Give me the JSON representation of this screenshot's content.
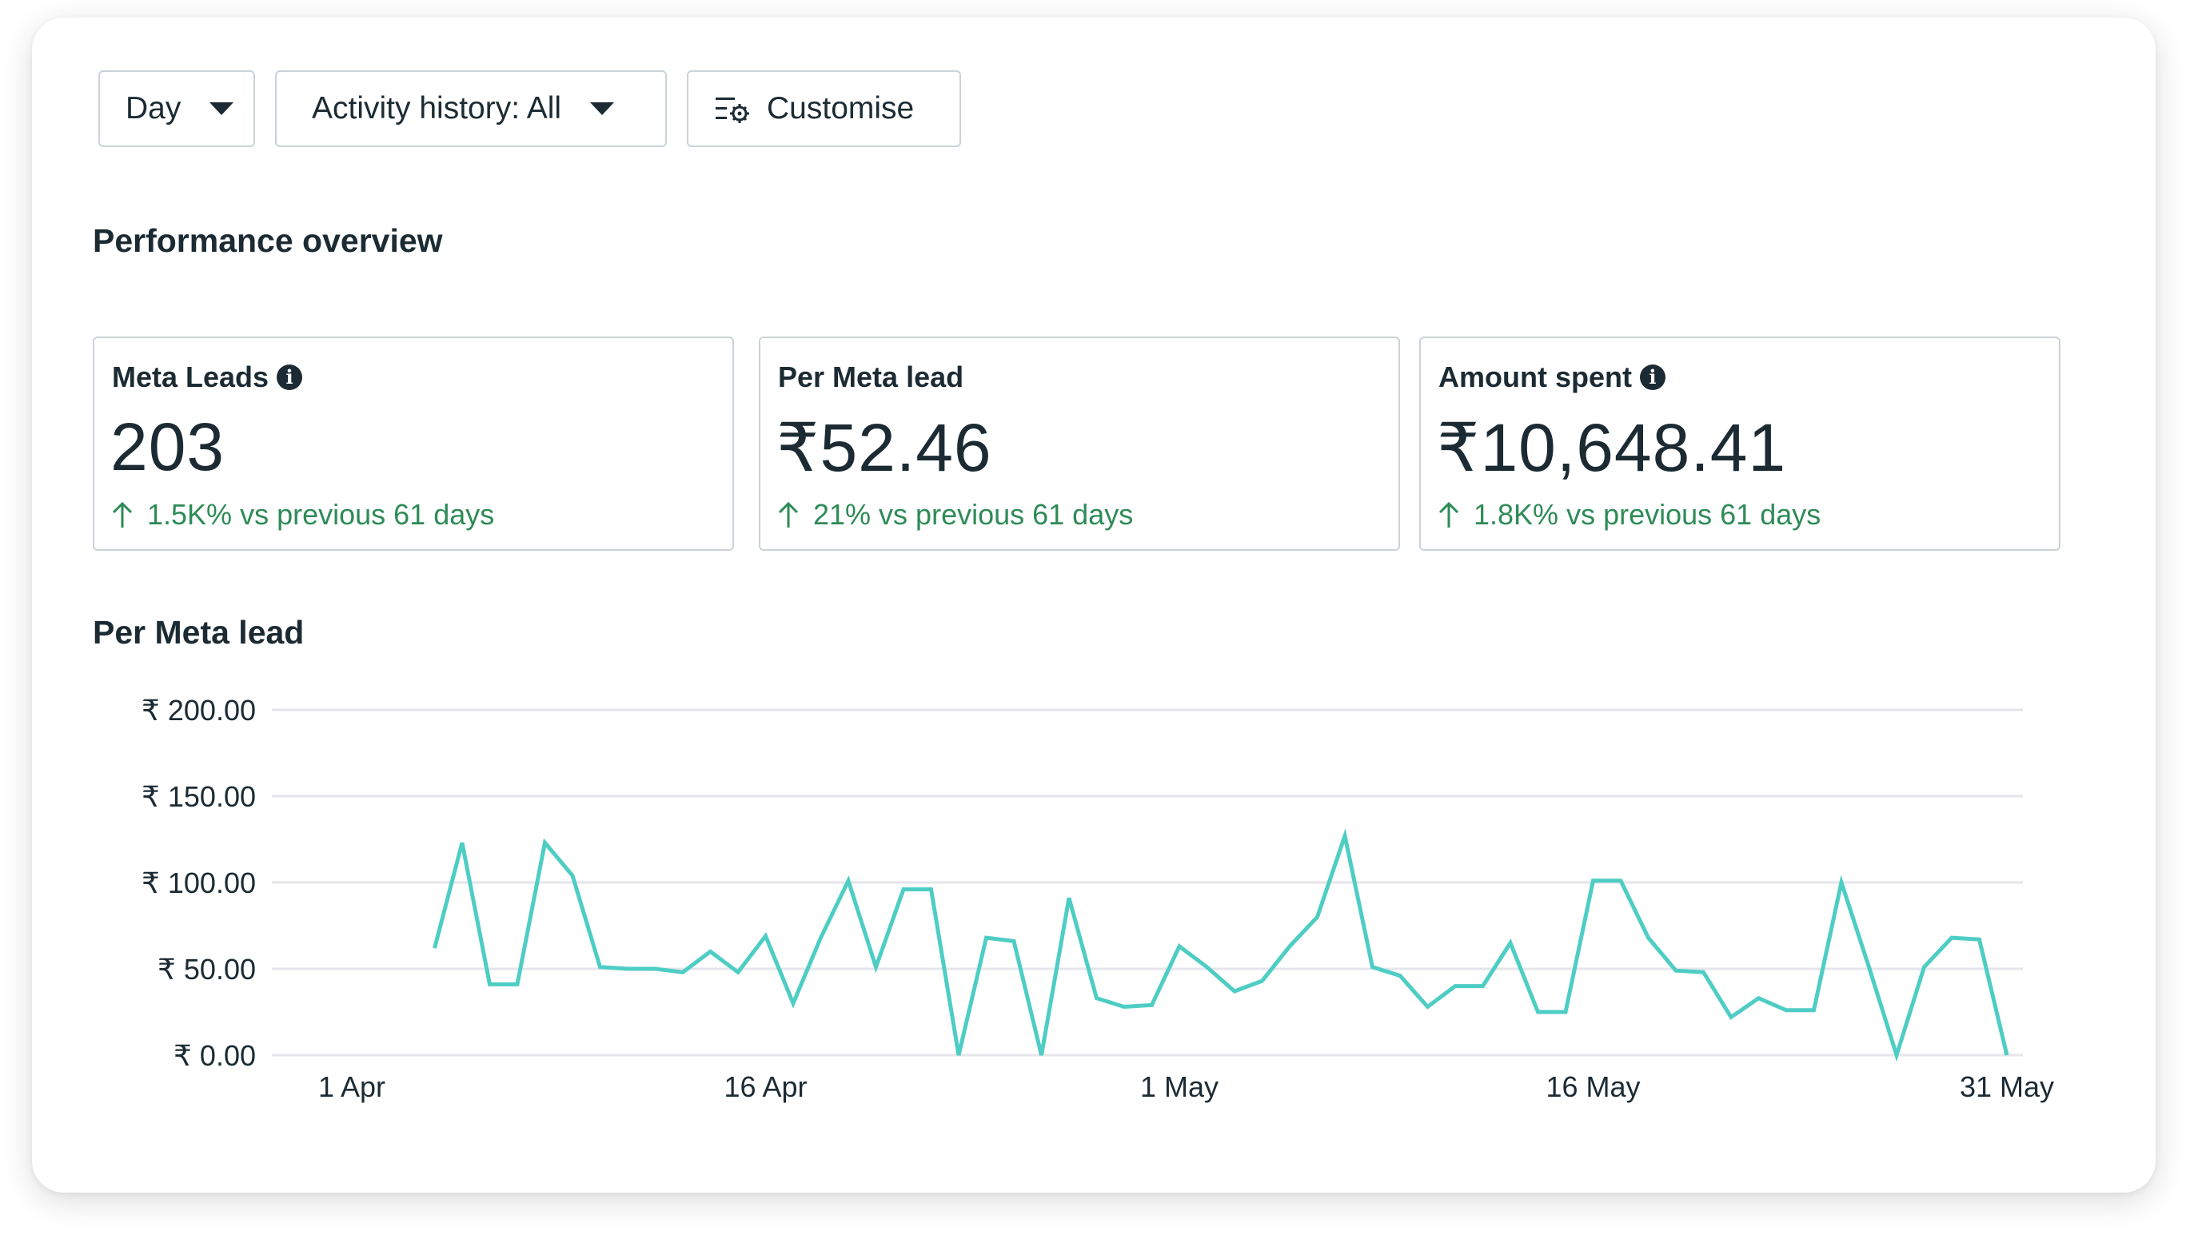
{
  "toolbar": {
    "day_label": "Day",
    "activity_label": "Activity history: All",
    "customise_label": "Customise"
  },
  "performance_overview": {
    "title": "Performance overview",
    "metrics": [
      {
        "label": "Meta Leads",
        "value": "203",
        "delta": "1.5K% vs previous 61 days",
        "has_info": true
      },
      {
        "label": "Per Meta lead",
        "value": "₹52.46",
        "delta": "21% vs previous 61 days",
        "has_info": false
      },
      {
        "label": "Amount spent",
        "value": "₹10,648.41",
        "delta": "1.8K% vs previous 61 days",
        "has_info": true
      }
    ]
  },
  "colors": {
    "line": "#4ecdc4",
    "positive": "#2e8b57",
    "grid": "#e4e6eb"
  },
  "chart_data": {
    "type": "line",
    "title": "Per Meta lead",
    "ylim": [
      0,
      200
    ],
    "y_ticks": [
      {
        "value": 0,
        "label": "₹ 0.00"
      },
      {
        "value": 50,
        "label": "₹ 50.00"
      },
      {
        "value": 100,
        "label": "₹ 100.00"
      },
      {
        "value": 150,
        "label": "₹ 150.00"
      },
      {
        "value": 200,
        "label": "₹ 200.00"
      }
    ],
    "x_range": [
      "2024-04-01",
      "2024-05-31"
    ],
    "x_ticks": [
      {
        "date": "2024-04-01",
        "label": "1 Apr"
      },
      {
        "date": "2024-04-16",
        "label": "16 Apr"
      },
      {
        "date": "2024-05-01",
        "label": "1 May"
      },
      {
        "date": "2024-05-16",
        "label": "16 May"
      },
      {
        "date": "2024-05-31",
        "label": "31 May"
      }
    ],
    "grid": true,
    "series": [
      {
        "x": [
          "2024-04-04",
          "2024-04-05",
          "2024-04-06",
          "2024-04-07",
          "2024-04-08",
          "2024-04-09",
          "2024-04-10",
          "2024-04-11",
          "2024-04-12",
          "2024-04-13",
          "2024-04-14",
          "2024-04-15",
          "2024-04-16",
          "2024-04-17",
          "2024-04-18",
          "2024-04-19",
          "2024-04-20",
          "2024-04-21",
          "2024-04-22",
          "2024-04-23",
          "2024-04-24",
          "2024-04-25",
          "2024-04-26",
          "2024-04-27",
          "2024-04-28",
          "2024-04-29",
          "2024-04-30",
          "2024-05-01",
          "2024-05-02",
          "2024-05-03",
          "2024-05-04",
          "2024-05-05",
          "2024-05-06",
          "2024-05-07",
          "2024-05-08",
          "2024-05-09",
          "2024-05-10",
          "2024-05-11",
          "2024-05-12",
          "2024-05-13",
          "2024-05-14",
          "2024-05-15",
          "2024-05-16",
          "2024-05-17",
          "2024-05-18",
          "2024-05-19",
          "2024-05-20",
          "2024-05-21",
          "2024-05-22",
          "2024-05-23",
          "2024-05-24",
          "2024-05-25",
          "2024-05-26",
          "2024-05-27",
          "2024-05-28",
          "2024-05-29",
          "2024-05-30",
          "2024-05-31"
        ],
        "values": [
          62,
          123,
          41,
          41,
          123,
          104,
          51,
          50,
          50,
          48,
          60,
          48,
          69,
          30,
          68,
          101,
          51,
          96,
          96,
          0,
          68,
          66,
          0,
          91,
          33,
          28,
          29,
          63,
          51,
          37,
          43,
          63,
          80,
          127,
          51,
          46,
          28,
          40,
          40,
          65,
          25,
          25,
          101,
          101,
          68,
          49,
          48,
          22,
          33,
          26,
          26,
          100,
          51,
          0,
          51,
          68,
          67,
          0
        ]
      }
    ]
  }
}
